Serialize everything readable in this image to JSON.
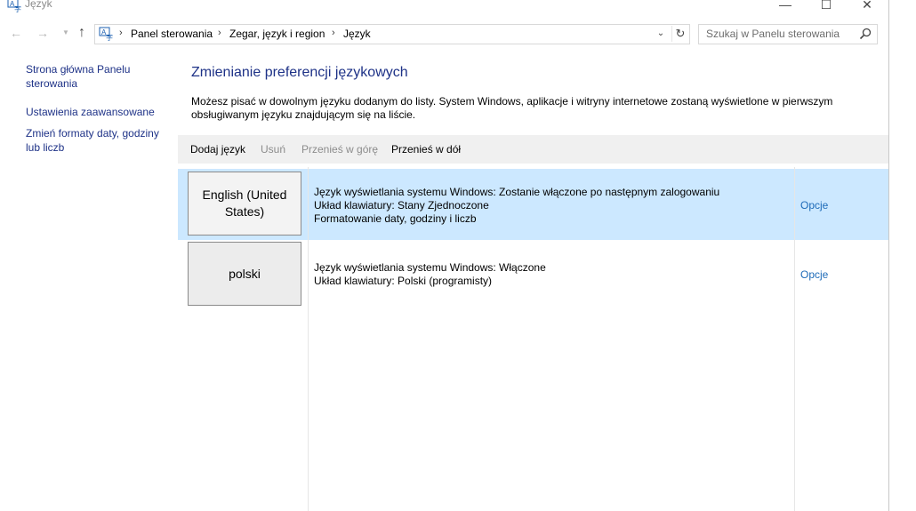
{
  "window": {
    "title": "Język",
    "minimize_glyph": "—",
    "maximize_glyph": "☐",
    "close_glyph": "✕"
  },
  "nav": {
    "back_glyph": "←",
    "forward_glyph": "→",
    "recent_glyph": "▼",
    "up_glyph": "↑"
  },
  "breadcrumb": {
    "separator": "›",
    "items": [
      "Panel sterowania",
      "Zegar, język i region",
      "Język"
    ],
    "dropdown_glyph": "⌄",
    "refresh_glyph": "↻"
  },
  "search": {
    "placeholder": "Szukaj w Panelu sterowania"
  },
  "sidebar": {
    "links": [
      {
        "label": "Strona główna Panelu sterowania"
      },
      {
        "label": "Ustawienia zaawansowane"
      },
      {
        "label": "Zmień formaty daty, godziny lub liczb"
      }
    ]
  },
  "main": {
    "title": "Zmienianie preferencji językowych",
    "description": "Możesz pisać w dowolnym języku dodanym do listy. System Windows, aplikacje i witryny internetowe zostaną wyświetlone w pierwszym obsługiwanym języku znajdującym się na liście.",
    "toolbar": {
      "add": "Dodaj język",
      "remove": "Usuń",
      "move_up": "Przenieś w górę",
      "move_down": "Przenieś w dół"
    },
    "languages": [
      {
        "name": "English (United States)",
        "selected": true,
        "details": [
          "Język wyświetlania systemu Windows: Zostanie włączone po następnym zalogowaniu",
          "Układ klawiatury: Stany Zjednoczone",
          "Formatowanie daty, godziny i liczb"
        ],
        "options": "Opcje"
      },
      {
        "name": "polski",
        "selected": false,
        "details": [
          "Język wyświetlania systemu Windows: Włączone",
          "Układ klawiatury: Polski (programisty)"
        ],
        "options": "Opcje"
      }
    ]
  },
  "colors": {
    "link": "#1e3287",
    "options_link": "#1e6bb8",
    "selection": "#cce8ff",
    "toolbar_bg": "#f0f0f0"
  },
  "icons": {
    "app": "language-icon",
    "search": "search-icon"
  }
}
